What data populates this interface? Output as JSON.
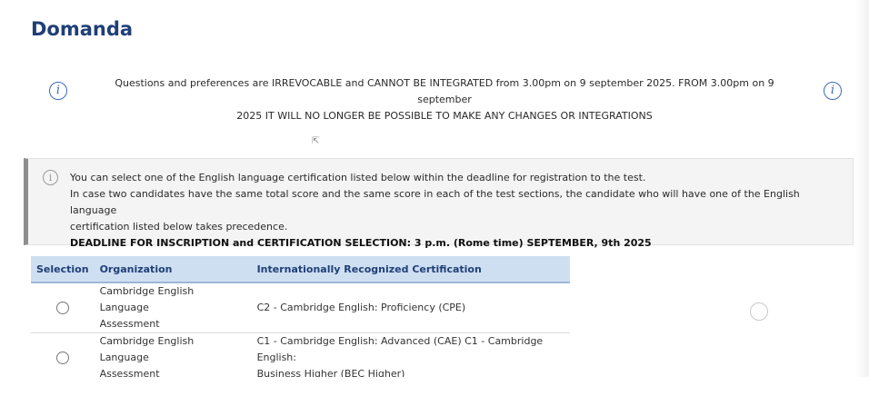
{
  "page": {
    "title": "Domanda"
  },
  "notice": {
    "line1": "Questions and preferences are IRREVOCABLE and CANNOT BE INTEGRATED from 3.00pm on 9 september 2025. FROM 3.00pm on 9 september",
    "line2": "2025 IT WILL NO LONGER BE POSSIBLE TO MAKE ANY CHANGES OR INTEGRATIONS",
    "icon_glyph": "i"
  },
  "info_box": {
    "icon_glyph": "i",
    "line1": "You can select one of the English language certification listed below within the deadline for registration to the test.",
    "line2": "In case two candidates have the same total score and the same score in each of the test sections, the candidate who will have one of the English language",
    "line3": "certification listed below takes precedence.",
    "deadline": "DEADLINE FOR INSCRIPTION and CERTIFICATION SELECTION: 3 p.m. (Rome time) SEPTEMBER, 9th 2025"
  },
  "table": {
    "headers": {
      "selection": "Selection",
      "organization": "Organization",
      "certification": "Internationally Recognized Certification"
    },
    "rows": [
      {
        "org_line1": "Cambridge English Language",
        "org_line2": "Assessment",
        "cert_line1": "C2 - Cambridge English: Proficiency (CPE)",
        "cert_line2": "",
        "selected": false
      },
      {
        "org_line1": "Cambridge English Language",
        "org_line2": "Assessment",
        "cert_line1": "C1 - Cambridge English: Advanced (CAE) C1 - Cambridge English:",
        "cert_line2": "Business Higher (BEC Higher)",
        "selected": false
      }
    ]
  },
  "colors": {
    "title": "#1f3f77",
    "info_icon": "#3c6bb3",
    "table_header_bg": "#cfdff2"
  }
}
